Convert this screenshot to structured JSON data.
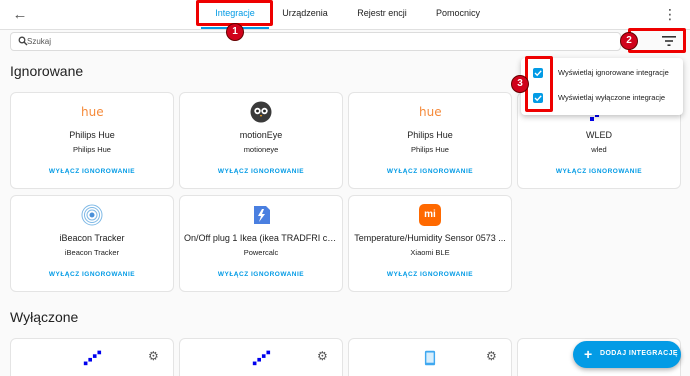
{
  "header": {
    "back_icon": "arrow-left-icon",
    "tabs": [
      {
        "label": "Integracje",
        "active": true
      },
      {
        "label": "Urządzenia",
        "active": false
      },
      {
        "label": "Rejestr encji",
        "active": false
      },
      {
        "label": "Pomocnicy",
        "active": false
      }
    ],
    "menu_icon": "dots-vertical-icon"
  },
  "search": {
    "placeholder": "Szukaj",
    "value": ""
  },
  "filter_icon": "filter-icon",
  "sections": {
    "ignored": "Ignorowane",
    "disabled": "Wyłączone"
  },
  "ignored_cards": [
    {
      "logo": "hue-logo",
      "logo_text": "hue",
      "title": "Philips Hue",
      "subtitle": "Philips Hue",
      "action": "WYŁĄCZ IGNOROWANIE"
    },
    {
      "logo": "motioneye-logo",
      "title": "motionEye",
      "subtitle": "motioneye",
      "action": "WYŁĄCZ IGNOROWANIE"
    },
    {
      "logo": "hue-logo",
      "logo_text": "hue",
      "title": "Philips Hue",
      "subtitle": "Philips Hue",
      "action": "WYŁĄCZ IGNOROWANIE"
    },
    {
      "logo": "wled-logo",
      "title": "WLED",
      "subtitle": "wled",
      "action": "WYŁĄCZ IGNOROWANIE"
    },
    {
      "logo": "ibeacon-logo",
      "title": "iBeacon Tracker",
      "subtitle": "iBeacon Tracker",
      "action": "WYŁĄCZ IGNOROWANIE"
    },
    {
      "logo": "powercalc-logo",
      "title": "On/Off plug 1 Ikea (ikea TRADFRI co...",
      "subtitle": "Powercalc",
      "action": "WYŁĄCZ IGNOROWANIE"
    },
    {
      "logo": "xiaomi-logo",
      "logo_text": "mi",
      "title": "Temperature/Humidity Sensor 0573 ...",
      "subtitle": "Xiaomi BLE",
      "action": "WYŁĄCZ IGNOROWANIE"
    }
  ],
  "disabled_cards": [
    {
      "logo": "wled-logo",
      "settings_icon": "gear-icon"
    },
    {
      "logo": "wled-logo",
      "settings_icon": "gear-icon"
    },
    {
      "logo": "phone-logo",
      "settings_icon": "gear-icon"
    },
    {
      "logo": "wled-logo"
    }
  ],
  "dropdown": {
    "items": [
      {
        "label": "Wyświetlaj ignorowane integracje",
        "checked": true
      },
      {
        "label": "Wyświetlaj wyłączone integracje",
        "checked": true
      }
    ]
  },
  "annotations": [
    "1",
    "2",
    "3"
  ],
  "fab": {
    "icon": "plus-icon",
    "label": "DODAJ INTEGRACJĘ"
  },
  "colors": {
    "accent": "#039be5",
    "annotation": "#e00000",
    "xiaomi": "#ff6900",
    "wled": "#0000ee"
  }
}
